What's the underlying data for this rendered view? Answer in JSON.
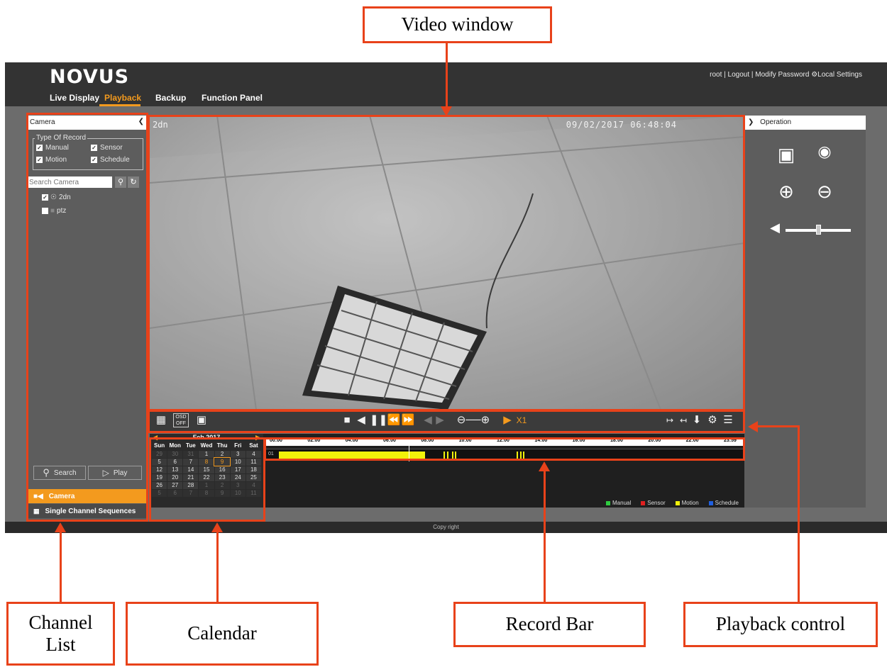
{
  "callouts": {
    "video_window": "Video window",
    "channel_list": "Channel\nList",
    "calendar": "Calendar",
    "record_bar": "Record Bar",
    "playback_control": "Playback control"
  },
  "app": {
    "logo": "NOVUS",
    "nav": [
      "Live Display",
      "Playback",
      "Backup",
      "Function Panel"
    ],
    "active_tab": "Playback",
    "user_links": "root | Logout | Modify Password",
    "local_settings": "Local Settings"
  },
  "left_panel": {
    "title": "Camera",
    "type_of_record": "Type Of Record",
    "record_types": [
      "Manual",
      "Sensor",
      "Motion",
      "Schedule"
    ],
    "search_placeholder": "Search Camera",
    "cameras": [
      {
        "label": "2dn",
        "checked": true
      },
      {
        "label": "ptz",
        "checked": false
      }
    ],
    "search_button": "Search",
    "play_button": "Play",
    "camera_item": "Camera",
    "sequences_item": "Single Channel Sequences"
  },
  "video": {
    "osd_left": "2dn",
    "osd_right": "09/02/2017 06:48:04"
  },
  "controls": {
    "osd_label": "OSD\nOFF",
    "speed": "X1"
  },
  "calendar": {
    "month": "Feb 2017",
    "weekdays": [
      "Sun",
      "Mon",
      "Tue",
      "Wed",
      "Thu",
      "Fri",
      "Sat"
    ],
    "weeks": [
      [
        "29",
        "30",
        "31",
        "1",
        "2",
        "3",
        "4"
      ],
      [
        "5",
        "6",
        "7",
        "8",
        "9",
        "10",
        "11"
      ],
      [
        "12",
        "13",
        "14",
        "15",
        "16",
        "17",
        "18"
      ],
      [
        "19",
        "20",
        "21",
        "22",
        "23",
        "24",
        "25"
      ],
      [
        "26",
        "27",
        "28",
        "1",
        "2",
        "3",
        "4"
      ],
      [
        "5",
        "6",
        "7",
        "8",
        "9",
        "10",
        "11"
      ]
    ]
  },
  "timeline": {
    "ticks": [
      "00:00",
      "02:00",
      "04:00",
      "06:00",
      "08:00",
      "10:00",
      "12:00",
      "14:00",
      "16:00",
      "18:00",
      "20:00",
      "22:00",
      "23:59"
    ],
    "channel": "01",
    "current_time": "06:48"
  },
  "legend": [
    {
      "label": "Manual",
      "color": "#2ecc40"
    },
    {
      "label": "Sensor",
      "color": "#e02020"
    },
    {
      "label": "Motion",
      "color": "#f2f20a"
    },
    {
      "label": "Schedule",
      "color": "#2060e0"
    }
  ],
  "right_panel": {
    "title": "Operation"
  },
  "footer": "Copy right",
  "colors": {
    "accent": "#f39a1e",
    "callout": "#e8421a"
  }
}
